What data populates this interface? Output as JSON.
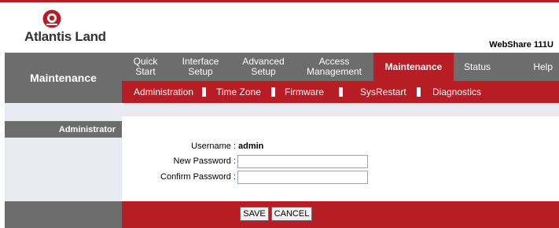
{
  "brand": {
    "logo_text": "Atlantis Land",
    "model": "WebShare 111U"
  },
  "nav": {
    "section": "Maintenance",
    "tabs": [
      {
        "label": "Quick\nStart",
        "active": false
      },
      {
        "label": "Interface\nSetup",
        "active": false
      },
      {
        "label": "Advanced\nSetup",
        "active": false
      },
      {
        "label": "Access\nManagement",
        "active": false
      },
      {
        "label": "Maintenance",
        "active": true
      },
      {
        "label": "Status",
        "active": false
      },
      {
        "label": "Help",
        "active": false
      }
    ],
    "subtabs": [
      "Administration",
      "Time Zone",
      "Firmware",
      "SysRestart",
      "Diagnostics"
    ]
  },
  "panel": {
    "title": "Administrator"
  },
  "form": {
    "username_label": "Username :",
    "username_value": "admin",
    "new_password_label": "New Password :",
    "new_password_value": "",
    "confirm_password_label": "Confirm Password :",
    "confirm_password_value": ""
  },
  "actions": {
    "save": "SAVE",
    "cancel": "CANCEL"
  },
  "colors": {
    "accent": "#b81c24",
    "nav_gray": "#6d6d6d",
    "panel_bg": "#e9e9f2"
  }
}
